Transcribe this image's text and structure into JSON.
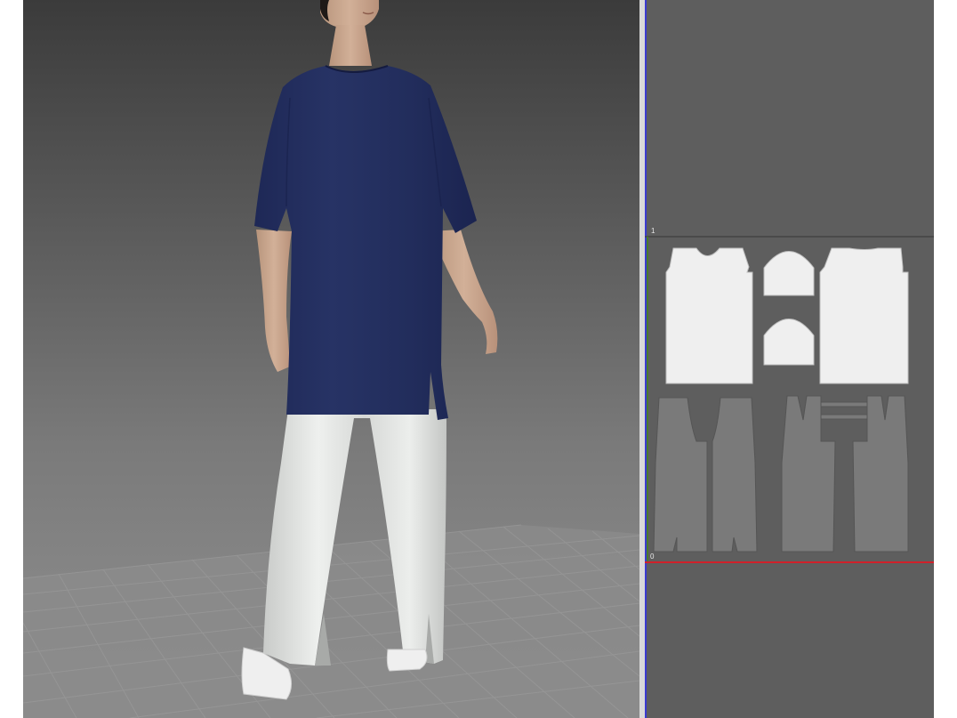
{
  "app": {
    "panes": [
      "3d-garment-window",
      "2d-pattern-window"
    ]
  },
  "viewport2d": {
    "axis_y_label": "1",
    "axis_origin_label": "0"
  },
  "colors": {
    "shirt": "#24305f",
    "pants": "#e6e8e6",
    "pattern_top_piece": "#efefef",
    "pattern_bottom_piece": "#7a7a7a",
    "axis_x": "#d0212a",
    "axis_y": "#4a7a2a",
    "axis_border": "#3b3bd0"
  }
}
